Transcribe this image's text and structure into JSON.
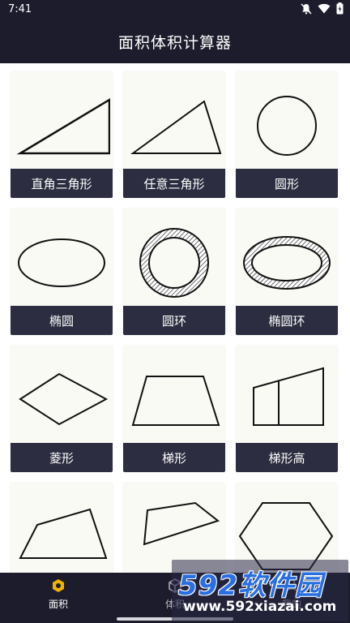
{
  "status_bar": {
    "time": "7:41",
    "icons": [
      "mute-icon",
      "wifi-icon",
      "battery-icon"
    ]
  },
  "app_bar": {
    "title": "面积体积计算器"
  },
  "shapes": [
    {
      "label": "直角三角形",
      "icon": "right-triangle"
    },
    {
      "label": "任意三角形",
      "icon": "triangle"
    },
    {
      "label": "圆形",
      "icon": "circle"
    },
    {
      "label": "椭圆",
      "icon": "ellipse"
    },
    {
      "label": "圆环",
      "icon": "annulus"
    },
    {
      "label": "椭圆环",
      "icon": "elliptical-annulus"
    },
    {
      "label": "菱形",
      "icon": "rhombus"
    },
    {
      "label": "梯形",
      "icon": "trapezoid"
    },
    {
      "label": "梯形高",
      "icon": "trapezoid-height"
    },
    {
      "label": "",
      "icon": "quadrilateral"
    },
    {
      "label": "",
      "icon": "irregular-quadrilateral"
    },
    {
      "label": "",
      "icon": "hexagon"
    }
  ],
  "bottom_nav": {
    "items": [
      {
        "label": "面积",
        "icon": "hexagon-icon",
        "active": true
      },
      {
        "label": "体积",
        "icon": "cube-icon",
        "active": false
      },
      {
        "label": "我的",
        "icon": "person-icon",
        "active": false
      }
    ]
  },
  "watermark": {
    "brand": "592软件园",
    "url": "www.592xiazai.com"
  },
  "colors": {
    "bar_background": "#1c1c2c",
    "card_label_background": "#2c2d40",
    "card_background": "#fafaf5",
    "accent": "#f0b400"
  }
}
